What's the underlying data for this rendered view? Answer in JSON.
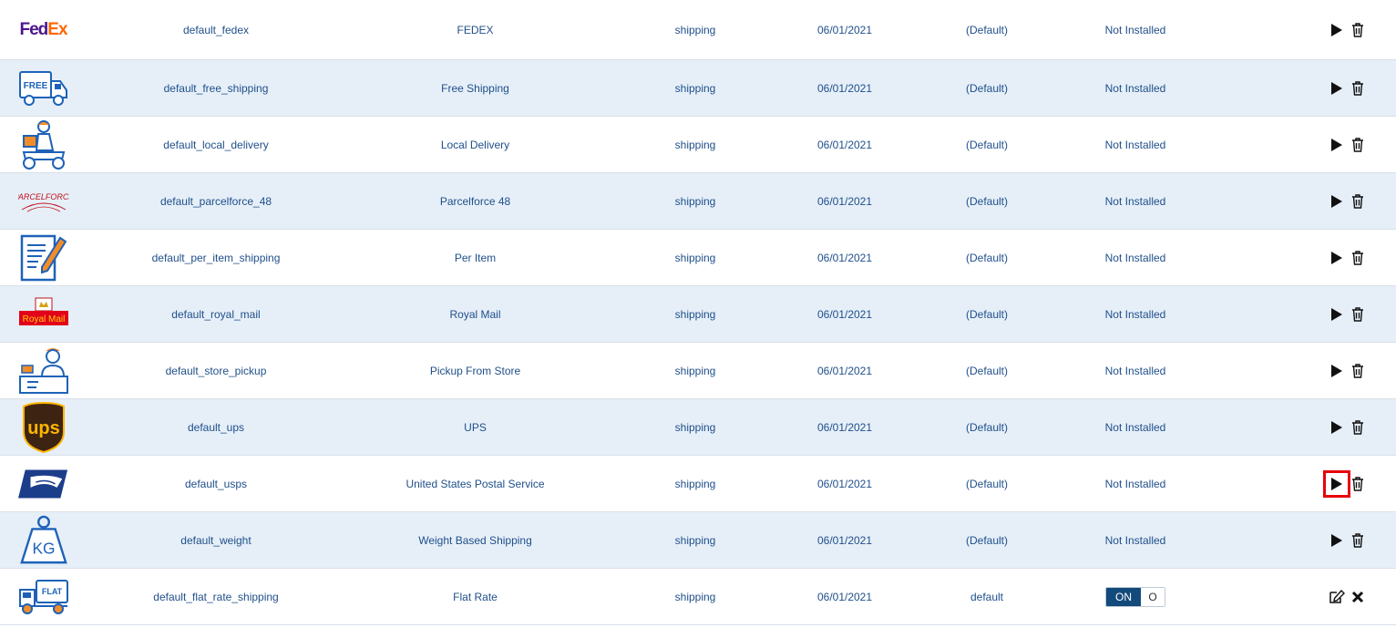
{
  "rows": [
    {
      "code": "default_fedex",
      "title": "FEDEX",
      "type": "shipping",
      "date": "06/01/2021",
      "default": "(Default)",
      "status": "Not Installed",
      "logo": "fedex-logo",
      "logo_text": "FedEx"
    },
    {
      "code": "default_free_shipping",
      "title": "Free Shipping",
      "type": "shipping",
      "date": "06/01/2021",
      "default": "(Default)",
      "status": "Not Installed",
      "logo": "free-truck-logo",
      "logo_text": "FREE"
    },
    {
      "code": "default_local_delivery",
      "title": "Local Delivery",
      "type": "shipping",
      "date": "06/01/2021",
      "default": "(Default)",
      "status": "Not Installed",
      "logo": "scooter-courier-logo"
    },
    {
      "code": "default_parcelforce_48",
      "title": "Parcelforce 48",
      "type": "shipping",
      "date": "06/01/2021",
      "default": "(Default)",
      "status": "Not Installed",
      "logo": "parcelforce-logo",
      "logo_text": "PARCELFORCE"
    },
    {
      "code": "default_per_item_shipping",
      "title": "Per Item",
      "type": "shipping",
      "date": "06/01/2021",
      "default": "(Default)",
      "status": "Not Installed",
      "logo": "document-pen-logo"
    },
    {
      "code": "default_royal_mail",
      "title": "Royal Mail",
      "type": "shipping",
      "date": "06/01/2021",
      "default": "(Default)",
      "status": "Not Installed",
      "logo": "royal-mail-logo",
      "logo_text": "Royal Mail"
    },
    {
      "code": "default_store_pickup",
      "title": "Pickup From Store",
      "type": "shipping",
      "date": "06/01/2021",
      "default": "(Default)",
      "status": "Not Installed",
      "logo": "store-clerk-logo"
    },
    {
      "code": "default_ups",
      "title": "UPS",
      "type": "shipping",
      "date": "06/01/2021",
      "default": "(Default)",
      "status": "Not Installed",
      "logo": "ups-logo",
      "logo_text": "ups"
    },
    {
      "code": "default_usps",
      "title": "United States Postal Service",
      "type": "shipping",
      "date": "06/01/2021",
      "default": "(Default)",
      "status": "Not Installed",
      "logo": "usps-eagle-logo"
    },
    {
      "code": "default_weight",
      "title": "Weight Based Shipping",
      "type": "shipping",
      "date": "06/01/2021",
      "default": "(Default)",
      "status": "Not Installed",
      "logo": "kg-weight-logo",
      "logo_text": "KG"
    },
    {
      "code": "default_flat_rate_shipping",
      "title": "Flat Rate",
      "type": "shipping",
      "date": "06/01/2021",
      "default": "default",
      "status": "",
      "logo": "flat-truck-logo",
      "logo_text": "FLAT",
      "toggle": {
        "on_label": "ON",
        "off_label": "O"
      }
    }
  ],
  "highlighted_row_index": 8,
  "colors": {
    "text": "#1f4f8a",
    "alt_row": "#e6eff8",
    "toggle_on": "#134a7c",
    "highlight": "#e8000b",
    "fedex_purple": "#4d148c",
    "fedex_orange": "#ff6600"
  },
  "icons": {
    "install": "play-icon",
    "delete": "trash-icon",
    "edit": "edit-icon",
    "remove": "close-icon"
  }
}
